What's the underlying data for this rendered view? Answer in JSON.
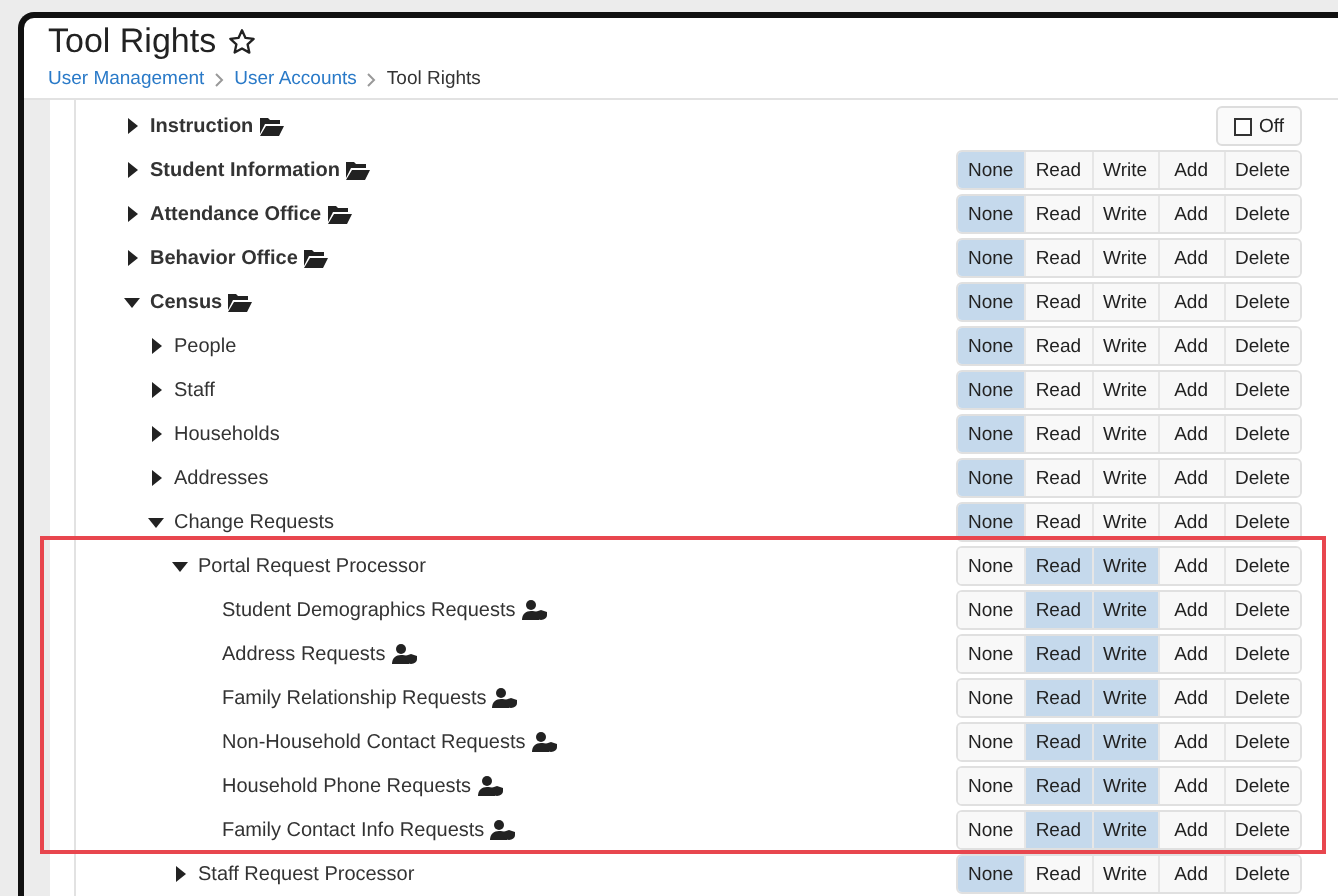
{
  "header": {
    "title": "Tool Rights",
    "breadcrumbs": [
      {
        "label": "User Management",
        "link": true
      },
      {
        "label": "User Accounts",
        "link": true
      },
      {
        "label": "Tool Rights",
        "link": false
      }
    ]
  },
  "tree": [
    {
      "label": "Instruction",
      "kind": "module",
      "expanded": false,
      "toggle": {
        "label": "Off",
        "checked": false
      }
    },
    {
      "label": "Student Information",
      "kind": "module",
      "expanded": false,
      "rights": [
        {
          "label": "None",
          "selected": true
        },
        {
          "label": "Read",
          "selected": false
        },
        {
          "label": "Write",
          "selected": false
        },
        {
          "label": "Add",
          "selected": false
        },
        {
          "label": "Delete",
          "selected": false
        }
      ]
    },
    {
      "label": "Attendance Office",
      "kind": "module",
      "expanded": false,
      "rights": [
        {
          "label": "None",
          "selected": true
        },
        {
          "label": "Read",
          "selected": false
        },
        {
          "label": "Write",
          "selected": false
        },
        {
          "label": "Add",
          "selected": false
        },
        {
          "label": "Delete",
          "selected": false
        }
      ]
    },
    {
      "label": "Behavior Office",
      "kind": "module",
      "expanded": false,
      "rights": [
        {
          "label": "None",
          "selected": true
        },
        {
          "label": "Read",
          "selected": false
        },
        {
          "label": "Write",
          "selected": false
        },
        {
          "label": "Add",
          "selected": false
        },
        {
          "label": "Delete",
          "selected": false
        }
      ]
    },
    {
      "label": "Census",
      "kind": "module",
      "expanded": true,
      "rights": [
        {
          "label": "None",
          "selected": true
        },
        {
          "label": "Read",
          "selected": false
        },
        {
          "label": "Write",
          "selected": false
        },
        {
          "label": "Add",
          "selected": false
        },
        {
          "label": "Delete",
          "selected": false
        }
      ],
      "children": [
        {
          "label": "People",
          "kind": "tool",
          "expanded": false,
          "rights": [
            {
              "label": "None",
              "selected": true
            },
            {
              "label": "Read",
              "selected": false
            },
            {
              "label": "Write",
              "selected": false
            },
            {
              "label": "Add",
              "selected": false
            },
            {
              "label": "Delete",
              "selected": false
            }
          ]
        },
        {
          "label": "Staff",
          "kind": "tool",
          "expanded": false,
          "rights": [
            {
              "label": "None",
              "selected": true
            },
            {
              "label": "Read",
              "selected": false
            },
            {
              "label": "Write",
              "selected": false
            },
            {
              "label": "Add",
              "selected": false
            },
            {
              "label": "Delete",
              "selected": false
            }
          ]
        },
        {
          "label": "Households",
          "kind": "tool",
          "expanded": false,
          "rights": [
            {
              "label": "None",
              "selected": true
            },
            {
              "label": "Read",
              "selected": false
            },
            {
              "label": "Write",
              "selected": false
            },
            {
              "label": "Add",
              "selected": false
            },
            {
              "label": "Delete",
              "selected": false
            }
          ]
        },
        {
          "label": "Addresses",
          "kind": "tool",
          "expanded": false,
          "rights": [
            {
              "label": "None",
              "selected": true
            },
            {
              "label": "Read",
              "selected": false
            },
            {
              "label": "Write",
              "selected": false
            },
            {
              "label": "Add",
              "selected": false
            },
            {
              "label": "Delete",
              "selected": false
            }
          ]
        },
        {
          "label": "Change Requests",
          "kind": "tool",
          "expanded": true,
          "rights": [
            {
              "label": "None",
              "selected": true
            },
            {
              "label": "Read",
              "selected": false
            },
            {
              "label": "Write",
              "selected": false
            },
            {
              "label": "Add",
              "selected": false
            },
            {
              "label": "Delete",
              "selected": false
            }
          ],
          "children": [
            {
              "label": "Portal Request Processor",
              "kind": "tool",
              "expanded": true,
              "highlighted": true,
              "rights": [
                {
                  "label": "None",
                  "selected": false
                },
                {
                  "label": "Read",
                  "selected": true
                },
                {
                  "label": "Write",
                  "selected": true
                },
                {
                  "label": "Add",
                  "selected": false
                },
                {
                  "label": "Delete",
                  "selected": false
                }
              ],
              "children": [
                {
                  "label": "Student Demographics Requests",
                  "kind": "request",
                  "rights": [
                    {
                      "label": "None",
                      "selected": false
                    },
                    {
                      "label": "Read",
                      "selected": true
                    },
                    {
                      "label": "Write",
                      "selected": true
                    },
                    {
                      "label": "Add",
                      "selected": false
                    },
                    {
                      "label": "Delete",
                      "selected": false
                    }
                  ]
                },
                {
                  "label": "Address Requests",
                  "kind": "request",
                  "rights": [
                    {
                      "label": "None",
                      "selected": false
                    },
                    {
                      "label": "Read",
                      "selected": true
                    },
                    {
                      "label": "Write",
                      "selected": true
                    },
                    {
                      "label": "Add",
                      "selected": false
                    },
                    {
                      "label": "Delete",
                      "selected": false
                    }
                  ]
                },
                {
                  "label": "Family Relationship Requests",
                  "kind": "request",
                  "rights": [
                    {
                      "label": "None",
                      "selected": false
                    },
                    {
                      "label": "Read",
                      "selected": true
                    },
                    {
                      "label": "Write",
                      "selected": true
                    },
                    {
                      "label": "Add",
                      "selected": false
                    },
                    {
                      "label": "Delete",
                      "selected": false
                    }
                  ]
                },
                {
                  "label": "Non-Household Contact Requests",
                  "kind": "request",
                  "rights": [
                    {
                      "label": "None",
                      "selected": false
                    },
                    {
                      "label": "Read",
                      "selected": true
                    },
                    {
                      "label": "Write",
                      "selected": true
                    },
                    {
                      "label": "Add",
                      "selected": false
                    },
                    {
                      "label": "Delete",
                      "selected": false
                    }
                  ]
                },
                {
                  "label": "Household Phone Requests",
                  "kind": "request",
                  "rights": [
                    {
                      "label": "None",
                      "selected": false
                    },
                    {
                      "label": "Read",
                      "selected": true
                    },
                    {
                      "label": "Write",
                      "selected": true
                    },
                    {
                      "label": "Add",
                      "selected": false
                    },
                    {
                      "label": "Delete",
                      "selected": false
                    }
                  ]
                },
                {
                  "label": "Family Contact Info Requests",
                  "kind": "request",
                  "rights": [
                    {
                      "label": "None",
                      "selected": false
                    },
                    {
                      "label": "Read",
                      "selected": true
                    },
                    {
                      "label": "Write",
                      "selected": true
                    },
                    {
                      "label": "Add",
                      "selected": false
                    },
                    {
                      "label": "Delete",
                      "selected": false
                    }
                  ]
                }
              ]
            },
            {
              "label": "Staff Request Processor",
              "kind": "tool",
              "expanded": false,
              "rights": [
                {
                  "label": "None",
                  "selected": true
                },
                {
                  "label": "Read",
                  "selected": false
                },
                {
                  "label": "Write",
                  "selected": false
                },
                {
                  "label": "Add",
                  "selected": false
                },
                {
                  "label": "Delete",
                  "selected": false
                }
              ]
            }
          ]
        }
      ]
    }
  ]
}
